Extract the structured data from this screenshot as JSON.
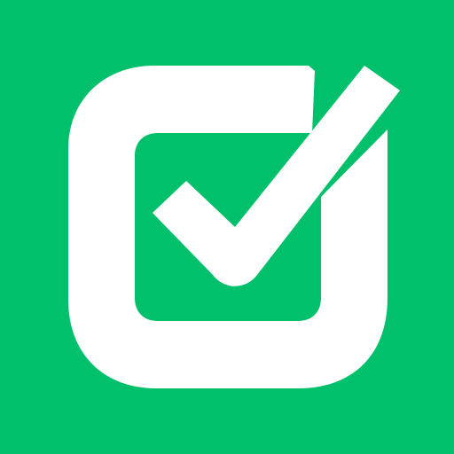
{
  "icon": {
    "name": "checkbox-checked-icon",
    "colors": {
      "background": "#00c06b",
      "foreground": "#ffffff"
    }
  }
}
